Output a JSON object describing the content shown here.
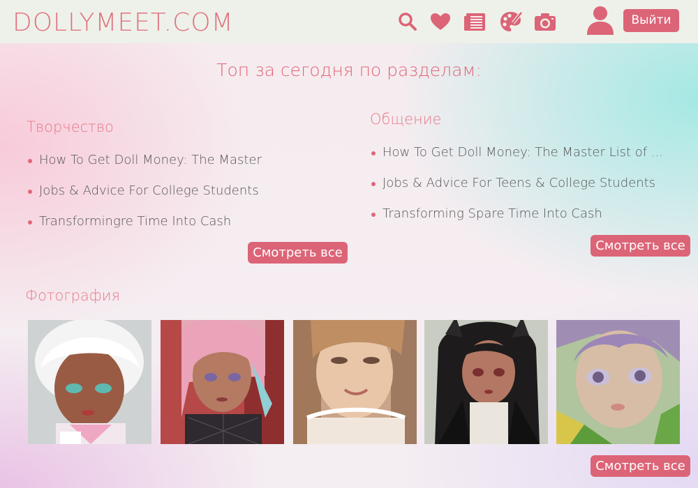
{
  "header": {
    "logo": "DOLLYMEET.COM",
    "icons": [
      "search-icon",
      "heart-icon",
      "articles-icon",
      "palette-icon",
      "camera-icon",
      "user-icon"
    ],
    "logout_label": "Выйти"
  },
  "main": {
    "title": "Топ за сегодня по разделам:",
    "sections": [
      {
        "title": "Творчество",
        "items": [
          "How To Get Doll Money: The Master",
          "Jobs & Advice For College Students",
          "Transformingre Time Into Cash"
        ],
        "see_all": "Смотреть все"
      },
      {
        "title": "Общение",
        "items": [
          "How To Get Doll Money: The Master List of ...",
          "Jobs & Advice For Teens & College Students",
          "Transforming Spare Time Into Cash"
        ],
        "see_all": "Смотреть все"
      }
    ],
    "photos": {
      "title": "Фотография",
      "see_all": "Смотреть все"
    }
  },
  "colors": {
    "accent": "#dc6477",
    "title": "#e06476",
    "topbar": "#eef1ea"
  }
}
